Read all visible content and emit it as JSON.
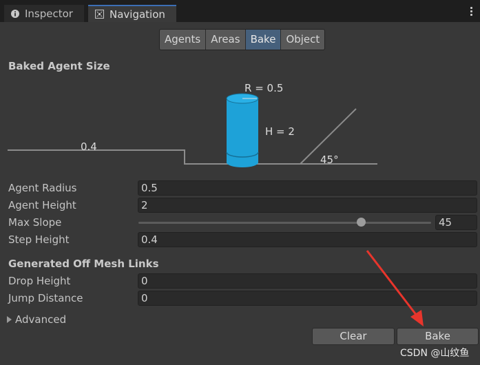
{
  "tabs": [
    {
      "label": "Inspector",
      "icon": "info-icon"
    },
    {
      "label": "Navigation",
      "icon": "navigation-icon"
    }
  ],
  "subtabs": [
    "Agents",
    "Areas",
    "Bake",
    "Object"
  ],
  "active_subtab": "Bake",
  "baked_agent_size": {
    "title": "Baked Agent Size",
    "diagram": {
      "radius_label": "R = 0.5",
      "height_label": "H = 2",
      "step_label": "0.4",
      "slope_label": "45°"
    }
  },
  "fields": {
    "agent_radius": {
      "label": "Agent Radius",
      "value": "0.5"
    },
    "agent_height": {
      "label": "Agent Height",
      "value": "2"
    },
    "max_slope": {
      "label": "Max Slope",
      "value": "45",
      "slider_fraction": 0.76
    },
    "step_height": {
      "label": "Step Height",
      "value": "0.4"
    }
  },
  "off_mesh": {
    "title": "Generated Off Mesh Links",
    "drop_height": {
      "label": "Drop Height",
      "value": "0"
    },
    "jump_distance": {
      "label": "Jump Distance",
      "value": "0"
    }
  },
  "advanced": {
    "label": "Advanced"
  },
  "buttons": {
    "clear": "Clear",
    "bake": "Bake"
  },
  "watermark": "CSDN @山纹鱼",
  "colors": {
    "cylinder": "#1ea2d8",
    "annotation_arrow": "#e8352c",
    "active_tab": "#46607c"
  }
}
